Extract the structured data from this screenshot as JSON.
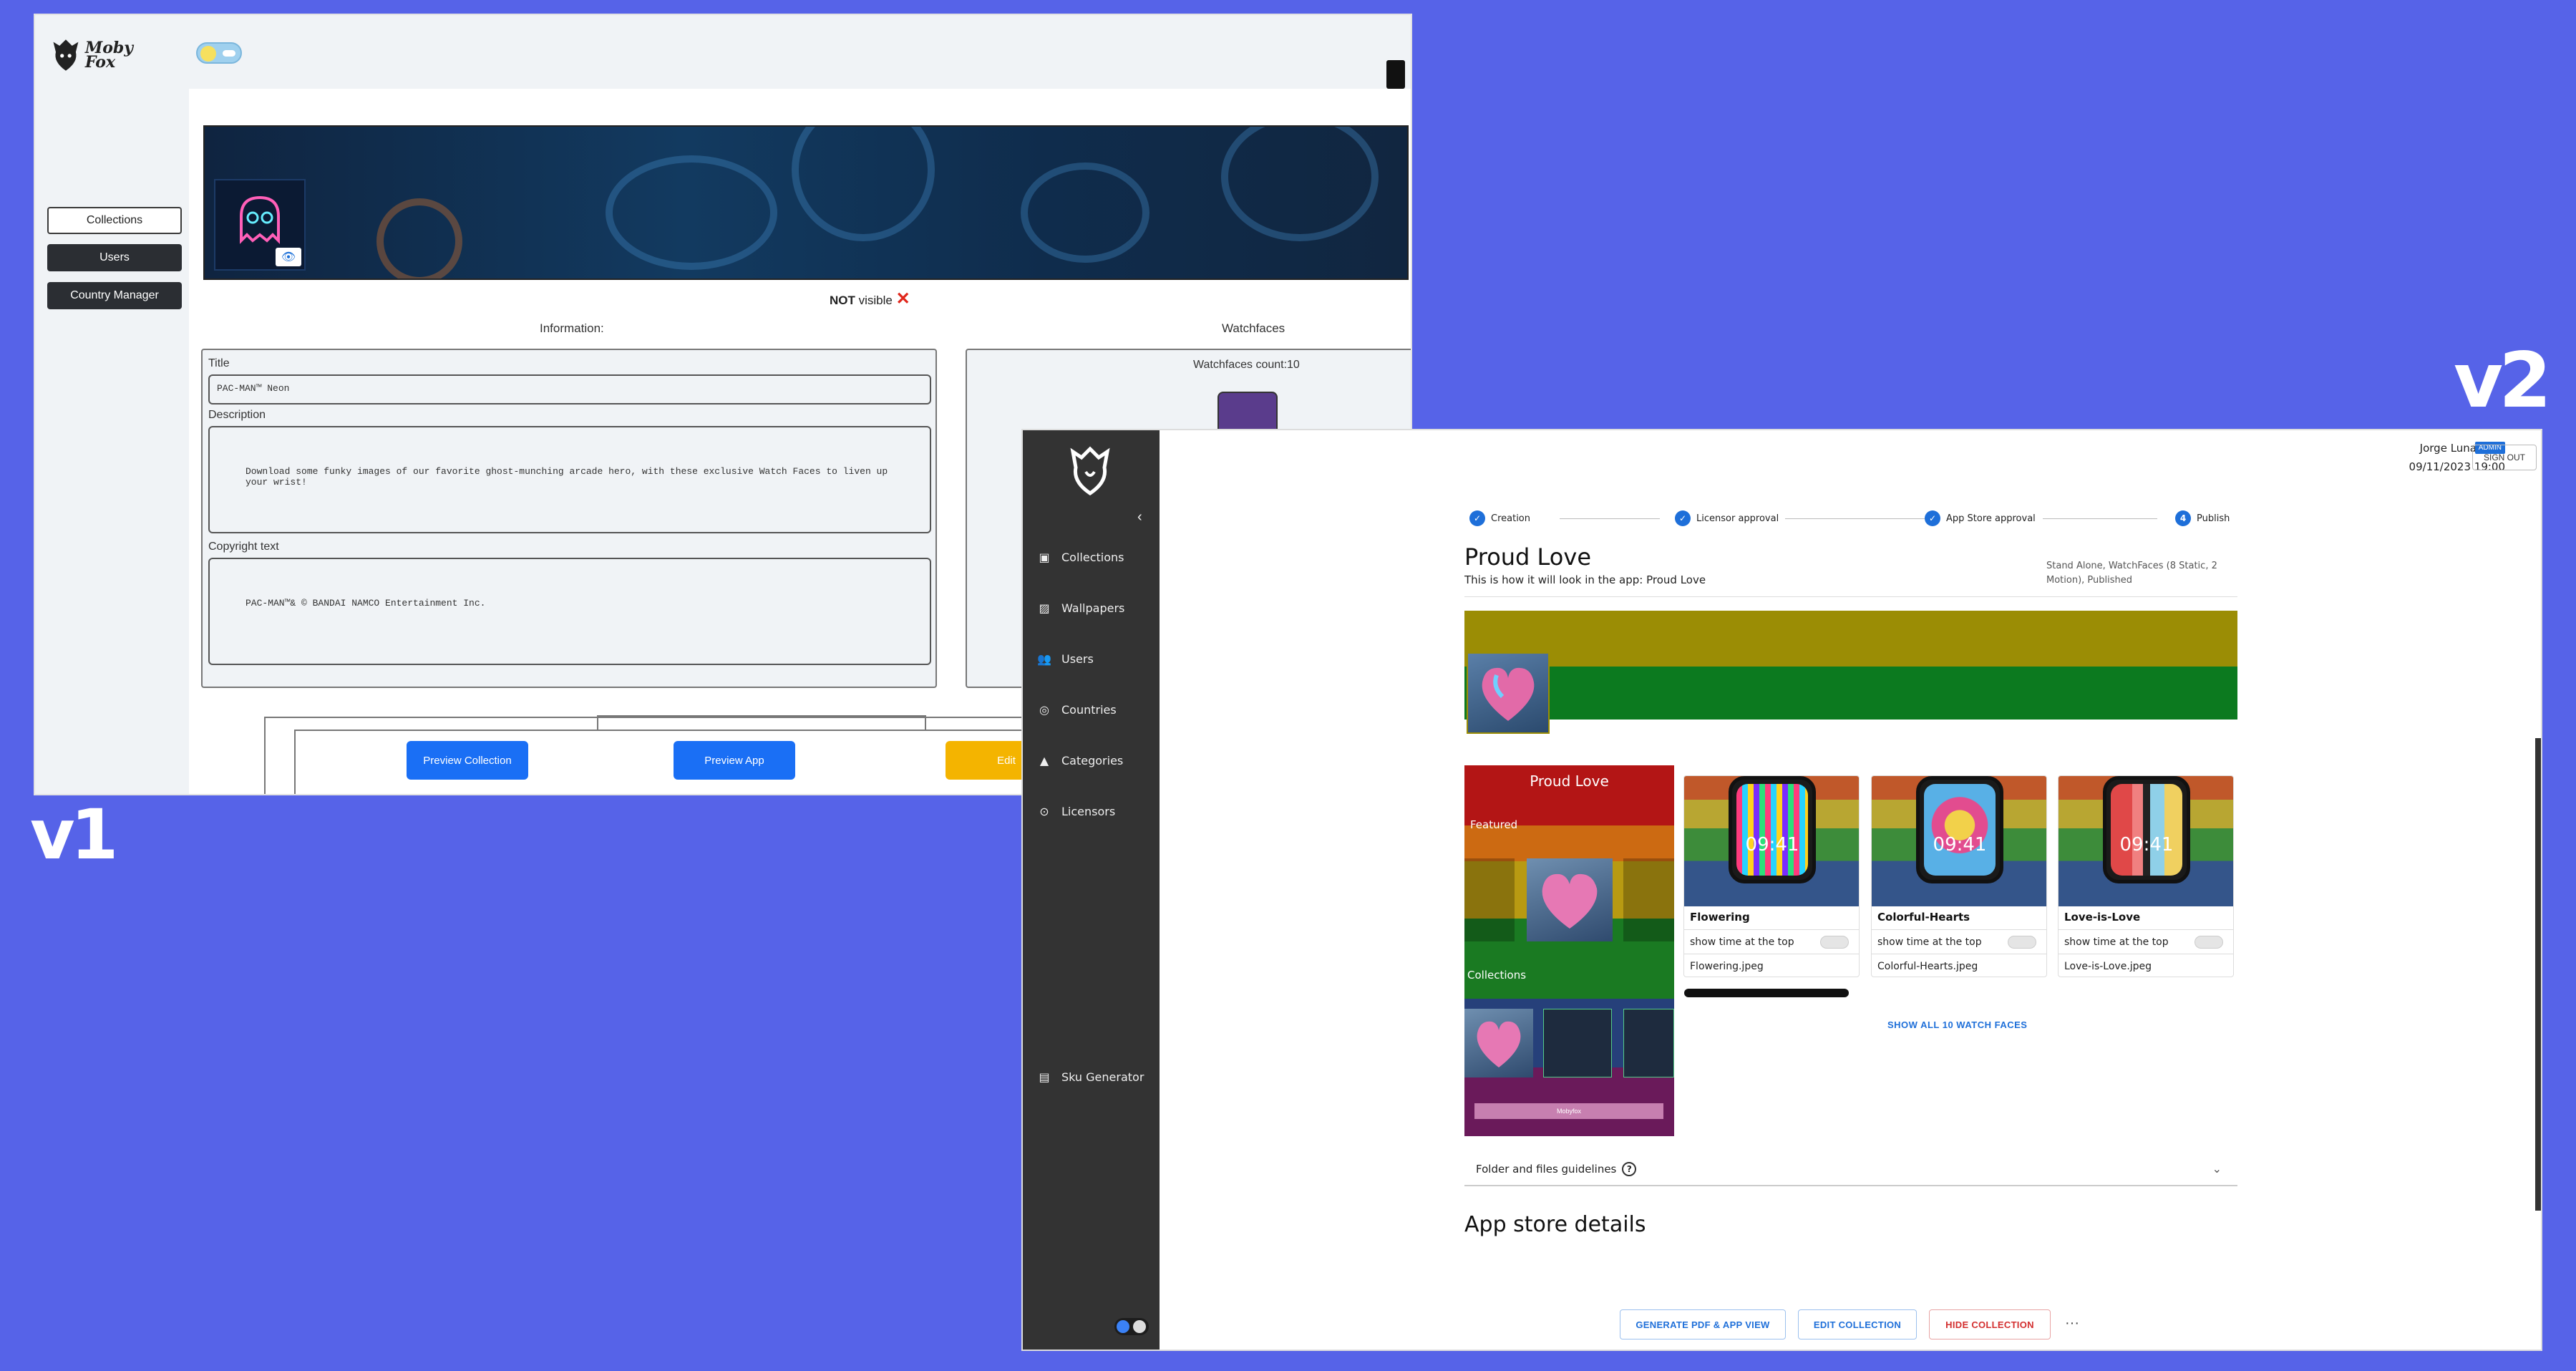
{
  "labels": {
    "v1": "v1",
    "v2": "v2"
  },
  "v1": {
    "nav": [
      "Collections",
      "Users",
      "Country Manager"
    ],
    "logo_text": "Moby Fox",
    "visibility_strong": "NOT",
    "visibility_rest": " visible",
    "information_heading": "Information:",
    "watchfaces_heading": "Watchfaces",
    "title_label": "Title",
    "title_value": "PAC-MAN™ Neon",
    "description_label": "Description",
    "description_value": "Download some funky images of our favorite ghost-munching arcade hero, with these exclusive Watch Faces to liven up your wrist!",
    "copyright_label": "Copyright text",
    "copyright_value": "PAC-MAN™& © BANDAI NAMCO Entertainment Inc.",
    "watchfaces_count": "Watchfaces count:10",
    "preview_collection": "Preview Collection",
    "preview_app": "Preview App",
    "edit": "Edit"
  },
  "v2": {
    "nav": [
      "Collections",
      "Wallpapers",
      "Users",
      "Countries",
      "Categories",
      "Licensors",
      "Sku Generator"
    ],
    "user_name": "Jorge Luna",
    "role_badge": "ADMIN",
    "datetime": "09/11/2023 19:00",
    "sign_out": "SIGN OUT",
    "steps": [
      {
        "label": "Creation",
        "mark": "✓"
      },
      {
        "label": "Licensor approval",
        "mark": "✓"
      },
      {
        "label": "App Store approval",
        "mark": "✓"
      },
      {
        "label": "Publish",
        "mark": "4"
      }
    ],
    "collection_title": "Proud Love",
    "app_look_text": "This is how it will look in the app:",
    "app_look_name": "Proud Love",
    "meta": "Stand Alone, WatchFaces (8 Static, 2 Motion), Published",
    "phone": {
      "title": "Proud Love",
      "featured": "Featured",
      "collections": "Collections",
      "footer": "Mobyfox"
    },
    "watchfaces": [
      {
        "name": "Flowering",
        "toggle_label": "show time at the top",
        "file": "Flowering.jpeg",
        "time": "09:41",
        "accent": "#111111"
      },
      {
        "name": "Colorful-Hearts",
        "toggle_label": "show time at the top",
        "file": "Colorful-Hearts.jpeg",
        "time": "09:41",
        "accent": "#d94f8a"
      },
      {
        "name": "Love-is-Love",
        "toggle_label": "show time at the top",
        "file": "Love-is-Love.jpeg",
        "time": "09:41",
        "accent": "#c23b3b"
      }
    ],
    "show_all": "SHOW ALL 10 WATCH FACES",
    "folder_guidelines": "Folder and files guidelines",
    "app_store_details": "App store details",
    "footer_buttons": [
      "GENERATE PDF & APP VIEW",
      "EDIT COLLECTION",
      "HIDE COLLECTION"
    ],
    "more": "···"
  }
}
